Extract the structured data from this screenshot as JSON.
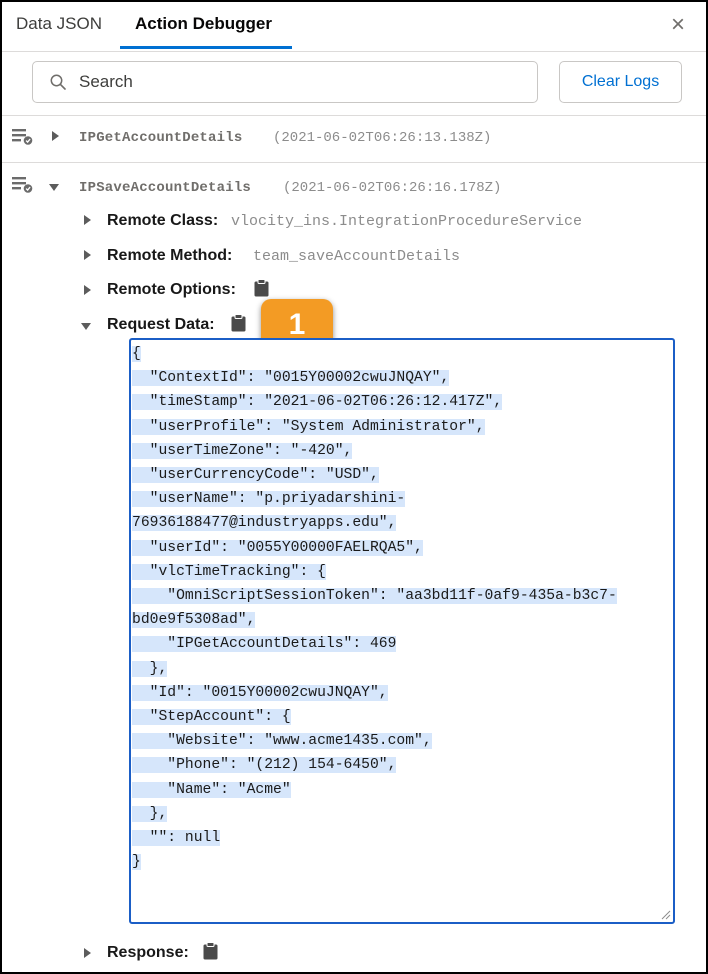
{
  "tabs": {
    "data_json": "Data JSON",
    "action_debugger": "Action Debugger",
    "close": "×"
  },
  "search": {
    "placeholder": "Search"
  },
  "clear_logs_label": "Clear Logs",
  "logs": [
    {
      "name": "IPGetAccountDetails",
      "time": "(2021-06-02T06:26:13.138Z)"
    },
    {
      "name": "IPSaveAccountDetails",
      "time": "(2021-06-02T06:26:16.178Z)"
    }
  ],
  "details": {
    "remote_class_label": "Remote Class:",
    "remote_class_value": "vlocity_ins.IntegrationProcedureService",
    "remote_method_label": "Remote Method:",
    "remote_method_value": "team_saveAccountDetails",
    "remote_options_label": "Remote Options:",
    "request_data_label": "Request Data:",
    "response_label": "Response:"
  },
  "badge": "1",
  "request_json_lines": [
    "{",
    "  \"ContextId\": \"0015Y00002cwuJNQAY\",",
    "  \"timeStamp\": \"2021-06-02T06:26:12.417Z\",",
    "  \"userProfile\": \"System Administrator\",",
    "  \"userTimeZone\": \"-420\",",
    "  \"userCurrencyCode\": \"USD\",",
    "  \"userName\": \"p.priyadarshini-",
    "76936188477@industryapps.edu\",",
    "  \"userId\": \"0055Y00000FAELRQA5\",",
    "  \"vlcTimeTracking\": {",
    "    \"OmniScriptSessionToken\": \"aa3bd11f-0af9-435a-b3c7-",
    "bd0e9f5308ad\",",
    "    \"IPGetAccountDetails\": 469",
    "  },",
    "  \"Id\": \"0015Y00002cwuJNQAY\",",
    "  \"StepAccount\": {",
    "    \"Website\": \"www.acme1435.com\",",
    "    \"Phone\": \"(212) 154-6450\",",
    "    \"Name\": \"Acme\"",
    "  },",
    "  \"\": null",
    "}"
  ],
  "colors": {
    "accent": "#0070d2",
    "badge": "#f39b24",
    "selection": "#d6e6fb",
    "box_border": "#1b5ec6"
  }
}
